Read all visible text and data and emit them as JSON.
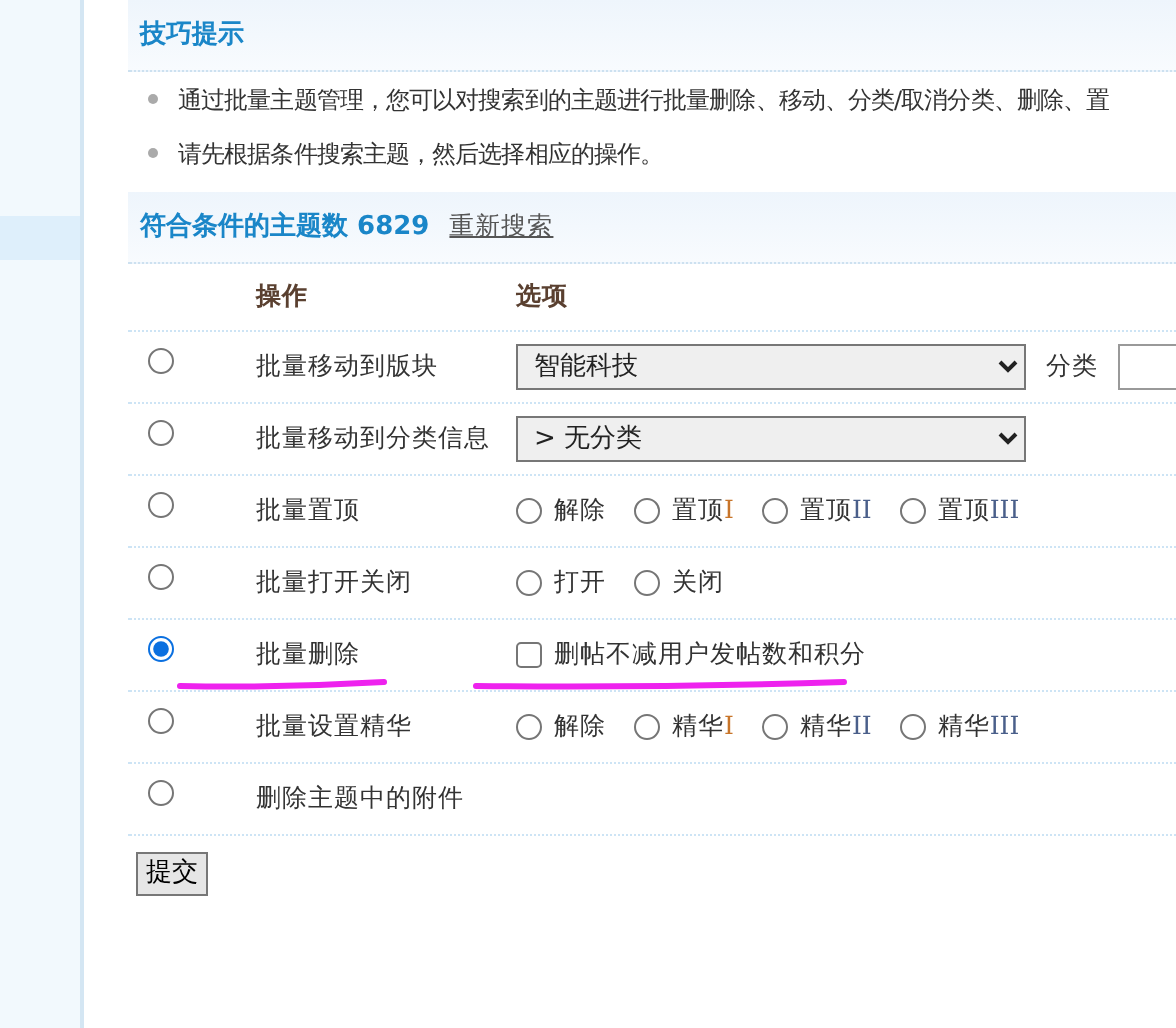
{
  "sidebar": {
    "items": [
      {
        "selected": true
      }
    ]
  },
  "tips": {
    "title": "技巧提示",
    "items": [
      "通过批量主题管理，您可以对搜索到的主题进行批量删除、移动、分类/取消分类、删除、置",
      "请先根据条件搜索主题，然后选择相应的操作。"
    ]
  },
  "result": {
    "label": "符合条件的主题数",
    "count": "6829",
    "link": "重新搜索"
  },
  "table": {
    "columns": [
      "操作",
      "选项"
    ],
    "rows": [
      {
        "selected": false,
        "label": "批量移动到版块",
        "kind": "select",
        "value": "智能科技",
        "extra_label": "分类",
        "underlined": false
      },
      {
        "selected": false,
        "label": "批量移动到分类信息",
        "kind": "select",
        "value": "  > 无分类",
        "underlined": false
      },
      {
        "selected": false,
        "label": "批量置顶",
        "kind": "radios",
        "underlined": false,
        "options": [
          {
            "label": "解除",
            "selected": false
          },
          {
            "label": "置顶",
            "suffix": "I",
            "color": "#c8752a",
            "selected": false
          },
          {
            "label": "置顶",
            "suffix": "II",
            "color": "#4a5f8a",
            "selected": false
          },
          {
            "label": "置顶",
            "suffix": "III",
            "color": "#4a5f8a",
            "selected": false
          }
        ]
      },
      {
        "selected": false,
        "label": "批量打开关闭",
        "kind": "radios",
        "underlined": false,
        "options": [
          {
            "label": "打开",
            "selected": false
          },
          {
            "label": "关闭",
            "selected": false
          }
        ]
      },
      {
        "selected": true,
        "label": "批量删除",
        "kind": "checkbox",
        "underlined": true,
        "option": {
          "label": "删帖不减用户发帖数和积分",
          "checked": false
        }
      },
      {
        "selected": false,
        "label": "批量设置精华",
        "kind": "radios",
        "underlined": false,
        "options": [
          {
            "label": "解除",
            "selected": false
          },
          {
            "label": "精华",
            "suffix": "I",
            "color": "#c8752a",
            "selected": false
          },
          {
            "label": "精华",
            "suffix": "II",
            "color": "#4a5f8a",
            "selected": false
          },
          {
            "label": "精华",
            "suffix": "III",
            "color": "#4a5f8a",
            "selected": false
          }
        ]
      },
      {
        "selected": false,
        "label": "删除主题中的附件",
        "kind": "none",
        "underlined": false
      }
    ]
  },
  "submit": "提交"
}
